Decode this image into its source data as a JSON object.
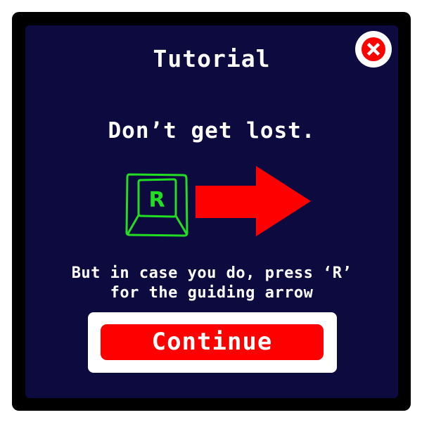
{
  "dialog": {
    "title": "Tutorial",
    "headline": "Don’t get lost.",
    "instruction_line1": "But in case you do, press ‘R’",
    "instruction_line2": "for the guiding arrow",
    "key_label": "R",
    "continue_label": "Continue"
  },
  "icons": {
    "close": "close-x-icon",
    "key": "keyboard-key-icon",
    "arrow": "right-arrow-icon"
  },
  "colors": {
    "background": "#0d0a3f",
    "frame": "#000000",
    "accent_red": "#ff0000",
    "key_green": "#22dd22",
    "text": "#ffffff"
  }
}
